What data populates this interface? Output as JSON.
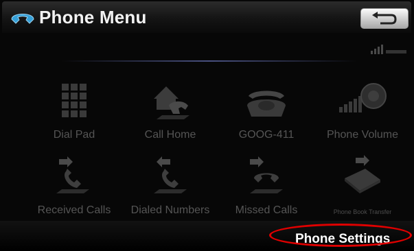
{
  "header": {
    "title": "Phone Menu",
    "title_icon": "phone-handset-icon",
    "back_icon": "return-arrow-icon"
  },
  "status": {
    "signal_icon": "signal-strength-icon"
  },
  "menu": {
    "items": [
      {
        "label": "Dial Pad",
        "icon": "keypad-icon"
      },
      {
        "label": "Call Home",
        "icon": "house-phone-icon"
      },
      {
        "label": "GOOG-411",
        "icon": "rotary-phone-icon"
      },
      {
        "label": "Phone Volume",
        "icon": "speaker-volume-icon"
      },
      {
        "label": "Received Calls",
        "icon": "received-call-icon"
      },
      {
        "label": "Dialed Numbers",
        "icon": "dialed-call-icon"
      },
      {
        "label": "Missed Calls",
        "icon": "missed-call-icon"
      },
      {
        "label": "Phone Book Transfer",
        "icon": "phonebook-transfer-icon"
      }
    ]
  },
  "footer": {
    "settings_label": "Phone Settings"
  },
  "colors": {
    "background": "#070707",
    "label_dim": "#555555",
    "highlight_oval": "#e00000",
    "text_bright": "#ffffff"
  }
}
